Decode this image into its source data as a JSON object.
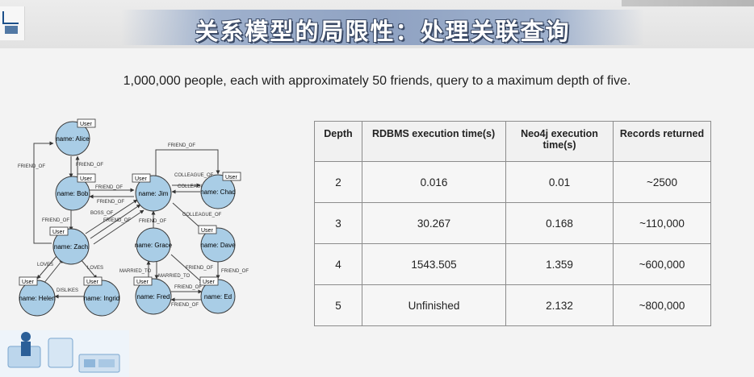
{
  "header": {
    "title": "关系模型的局限性：处理关联查询"
  },
  "subtitle": "1,000,000 people, each with approximately 50 friends, query to a maximum depth of five.",
  "graph": {
    "node_tag": "User",
    "nodes": {
      "alice": "name: Alice",
      "bob": "name: Bob",
      "jim": "name: Jim",
      "chad": "name: Chad",
      "zach": "name: Zach",
      "grace": "name: Grace",
      "dave": "name: Dave",
      "helen": "name: Helen",
      "ingrid": "name: Ingrid",
      "fred": "name: Fred",
      "ed": "name: Ed"
    },
    "edges": {
      "friend_of": "FRIEND_OF",
      "colleague_of": "COLLEAGUE_OF",
      "boss_of": "BOSS_OF",
      "loves": "LOVES",
      "dislikes": "DISLIKES",
      "married_to": "MARRIED_TO"
    }
  },
  "table": {
    "headers": [
      "Depth",
      "RDBMS execution time(s)",
      "Neo4j execution time(s)",
      "Records returned"
    ],
    "rows": [
      [
        "2",
        "0.016",
        "0.01",
        "~2500"
      ],
      [
        "3",
        "30.267",
        "0.168",
        "~110,000"
      ],
      [
        "4",
        "1543.505",
        "1.359",
        "~600,000"
      ],
      [
        "5",
        "Unfinished",
        "2.132",
        "~800,000"
      ]
    ]
  },
  "colors": {
    "node_fill": "#a9cde6",
    "banner": "#8fa2c2",
    "title_text": "#ffffff"
  }
}
